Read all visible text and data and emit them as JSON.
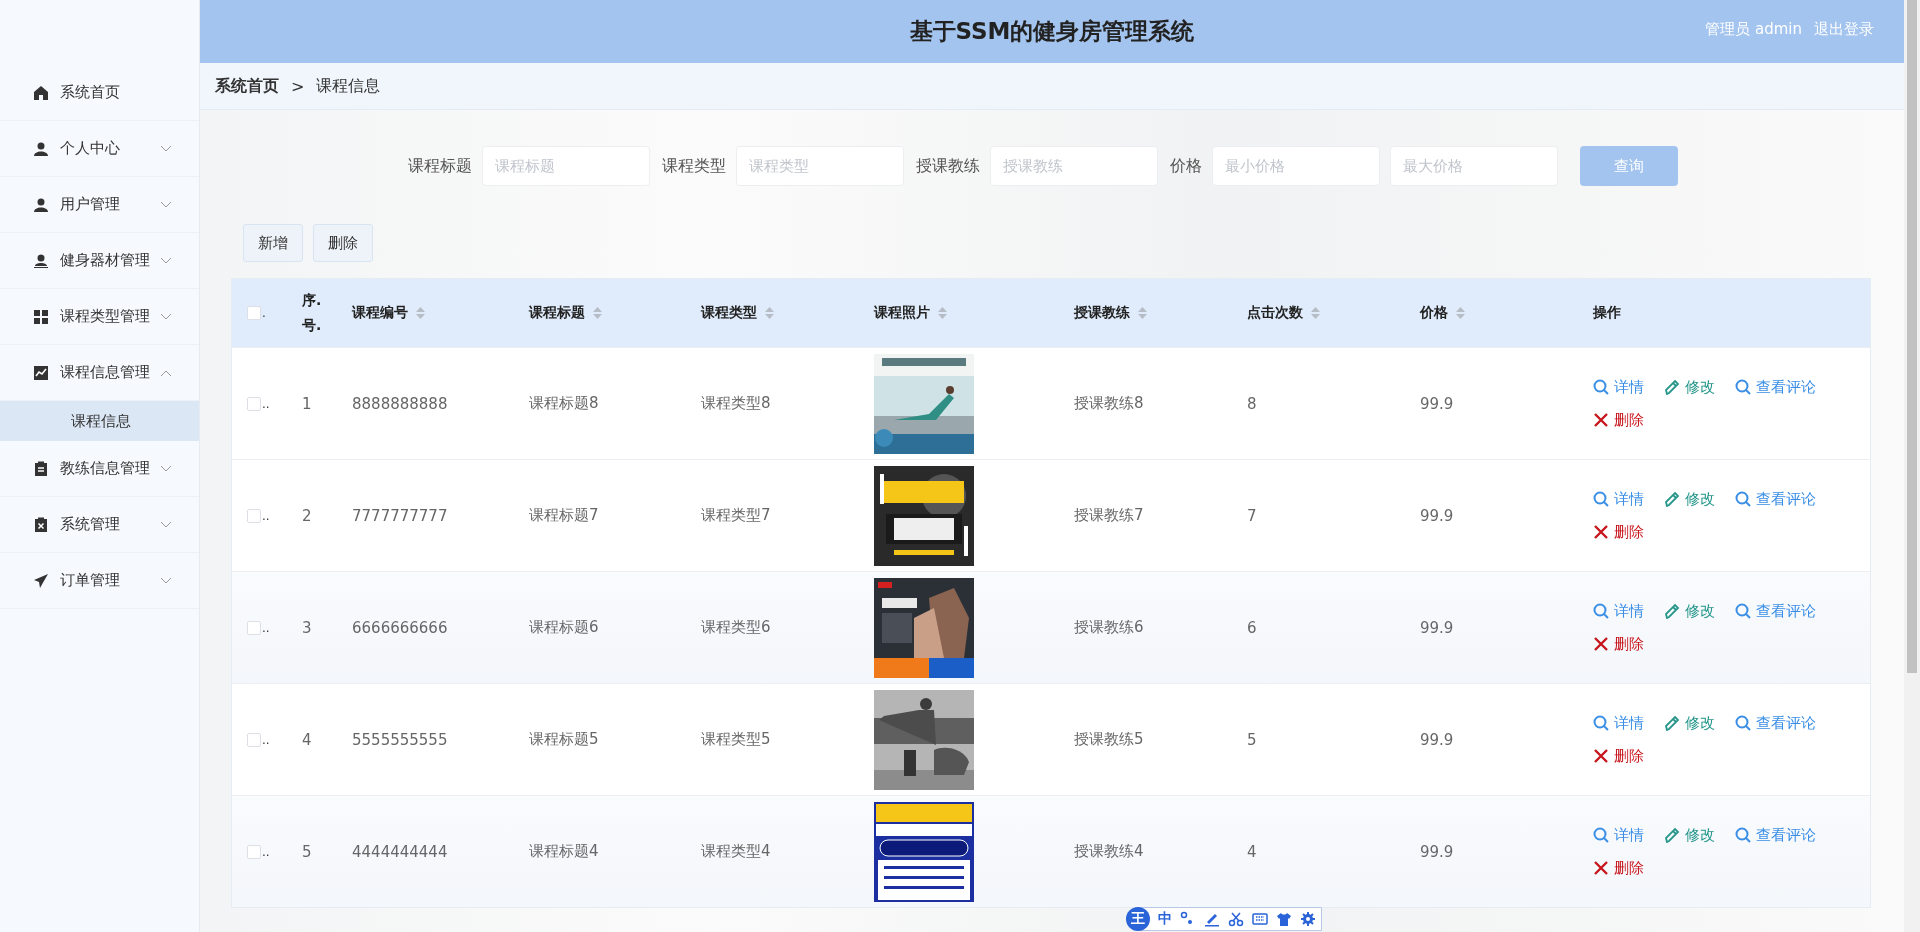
{
  "header": {
    "title": "基于SSM的健身房管理系统",
    "user": "管理员 admin",
    "logout": "退出登录"
  },
  "sidebar": {
    "items": [
      {
        "label": "系统首页",
        "kind": "link"
      },
      {
        "label": "个人中心",
        "kind": "submenu",
        "expanded": false
      },
      {
        "label": "用户管理",
        "kind": "submenu",
        "expanded": false
      },
      {
        "label": "健身器材管理",
        "kind": "submenu",
        "expanded": false
      },
      {
        "label": "课程类型管理",
        "kind": "submenu",
        "expanded": false
      },
      {
        "label": "课程信息管理",
        "kind": "submenu",
        "expanded": true,
        "children": [
          {
            "label": "课程信息",
            "selected": true
          }
        ]
      },
      {
        "label": "教练信息管理",
        "kind": "submenu",
        "expanded": false
      },
      {
        "label": "系统管理",
        "kind": "submenu",
        "expanded": false
      },
      {
        "label": "订单管理",
        "kind": "submenu",
        "expanded": false
      }
    ]
  },
  "breadcrumb": {
    "items": [
      "系统首页",
      "课程信息"
    ],
    "separator": ">"
  },
  "search": {
    "fields": [
      {
        "label": "课程标题",
        "placeholder": "课程标题"
      },
      {
        "label": "课程类型",
        "placeholder": "课程类型"
      },
      {
        "label": "授课教练",
        "placeholder": "授课教练"
      },
      {
        "label": "价格",
        "placeholder": "最小价格"
      },
      {
        "placeholder": "最大价格"
      }
    ],
    "button": "查询"
  },
  "toolbar": {
    "buttons": [
      "新增",
      "删除"
    ]
  },
  "table": {
    "select_all": {
      "checked": false,
      "mark": "."
    },
    "columns": [
      {
        "label": "序.号.",
        "sortable": false
      },
      {
        "label": "课程编号",
        "sortable": true
      },
      {
        "label": "课程标题",
        "sortable": true
      },
      {
        "label": "课程类型",
        "sortable": true
      },
      {
        "label": "课程照片",
        "sortable": true
      },
      {
        "label": "授课教练",
        "sortable": true
      },
      {
        "label": "点击次数",
        "sortable": true
      },
      {
        "label": "价格",
        "sortable": true
      },
      {
        "label": "操作",
        "sortable": false
      }
    ],
    "rows": [
      {
        "checked": false,
        "mark": "..",
        "index": "1",
        "code": "8888888888",
        "title": "课程标题8",
        "type": "课程类型8",
        "photo": {
          "kind": "picture"
        },
        "coach": "授课教练8",
        "clicks": "8",
        "price": "99.9",
        "actions": [
          {
            "kind": "detail",
            "label": "详情"
          },
          {
            "kind": "edit",
            "label": "修改"
          },
          {
            "kind": "comments",
            "label": "查看评论"
          },
          {
            "kind": "delete",
            "label": "删除"
          }
        ]
      },
      {
        "checked": false,
        "mark": "..",
        "index": "2",
        "code": "7777777777",
        "title": "课程标题7",
        "type": "课程类型7",
        "photo": {
          "kind": "picture"
        },
        "coach": "授课教练7",
        "clicks": "7",
        "price": "99.9",
        "actions": [
          {
            "kind": "detail",
            "label": "详情"
          },
          {
            "kind": "edit",
            "label": "修改"
          },
          {
            "kind": "comments",
            "label": "查看评论"
          },
          {
            "kind": "delete",
            "label": "删除"
          }
        ]
      },
      {
        "checked": false,
        "mark": "..",
        "index": "3",
        "code": "6666666666",
        "title": "课程标题6",
        "type": "课程类型6",
        "photo": {
          "kind": "picture"
        },
        "coach": "授课教练6",
        "clicks": "6",
        "price": "99.9",
        "actions": [
          {
            "kind": "detail",
            "label": "详情"
          },
          {
            "kind": "edit",
            "label": "修改"
          },
          {
            "kind": "comments",
            "label": "查看评论"
          },
          {
            "kind": "delete",
            "label": "删除"
          }
        ]
      },
      {
        "checked": false,
        "mark": "..",
        "index": "4",
        "code": "5555555555",
        "title": "课程标题5",
        "type": "课程类型5",
        "photo": {
          "kind": "picture"
        },
        "coach": "授课教练5",
        "clicks": "5",
        "price": "99.9",
        "actions": [
          {
            "kind": "detail",
            "label": "详情"
          },
          {
            "kind": "edit",
            "label": "修改"
          },
          {
            "kind": "comments",
            "label": "查看评论"
          },
          {
            "kind": "delete",
            "label": "删除"
          }
        ]
      },
      {
        "checked": false,
        "mark": "..",
        "index": "5",
        "code": "4444444444",
        "title": "课程标题4",
        "type": "课程类型4",
        "photo": {
          "kind": "picture"
        },
        "coach": "授课教练4",
        "clicks": "4",
        "price": "99.9",
        "actions": [
          {
            "kind": "detail",
            "label": "详情"
          },
          {
            "kind": "edit",
            "label": "修改"
          },
          {
            "kind": "comments",
            "label": "查看评论"
          },
          {
            "kind": "delete",
            "label": "删除"
          }
        ]
      }
    ]
  },
  "ime_toolbar": {
    "logo": "王",
    "mode": "中"
  }
}
